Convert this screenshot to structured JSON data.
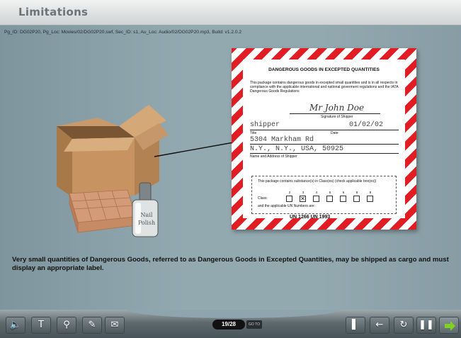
{
  "header": {
    "title": "Limitations"
  },
  "debug_info": "Pg_ID: DG02P20,  Pg_Loc: Movies/02/DG02P20.swf,  Sec_ID: s1,  Au_Loc: Audio/02/DG02P20.mp3,  Build: v1.2.0.2",
  "label": {
    "title": "DANGEROUS GOODS IN EXCEPTED QUANTITIES",
    "body": "This package contains dangerous goods in excepted small quantities and is in all respects in compliance with the applicable international and national goverment regulations and the IATA Dangerous Goods Regulations",
    "signature": "Mr John Doe",
    "signature_caption": "Signature of Shipper",
    "title_value": "shipper",
    "title_caption": "Title",
    "date_value": "01/02/02",
    "date_caption": "Date",
    "address_line1": "5304 Markham Rd",
    "address_line2": "N.Y., N.Y.,  USA,  50925",
    "address_caption": "Name and Address of Shipper",
    "class_text": "This package contains substance(s) in Class(es) (check applicable box(es))",
    "class_label": "Class:",
    "class_numbers": [
      "2",
      "3",
      "4",
      "5",
      "6",
      "8",
      "9"
    ],
    "checked_class": "3",
    "un_text": "and the applicable UN Numbers are:",
    "un_numbers": "UN 1266   UN 1993"
  },
  "illustration": {
    "bottle_text": "Nail Polish"
  },
  "description": "Very small quantities of Dangerous Goods, referred to as Dangerous Goods in Excepted Quantities, may be shipped as cargo and must display an appropriate label.",
  "toolbar": {
    "page_counter": "19/28",
    "goto_label": "GO TO",
    "left_icons": [
      "speaker-icon",
      "text-icon",
      "search-icon",
      "notes-icon",
      "mail-icon"
    ],
    "right_icons": [
      "exit-door-icon",
      "back-arrow-icon",
      "replay-icon",
      "pause-icon",
      "next-arrow-icon"
    ]
  },
  "colors": {
    "stripe_red": "#e11c22",
    "stage_bg": "#93a9b0"
  }
}
